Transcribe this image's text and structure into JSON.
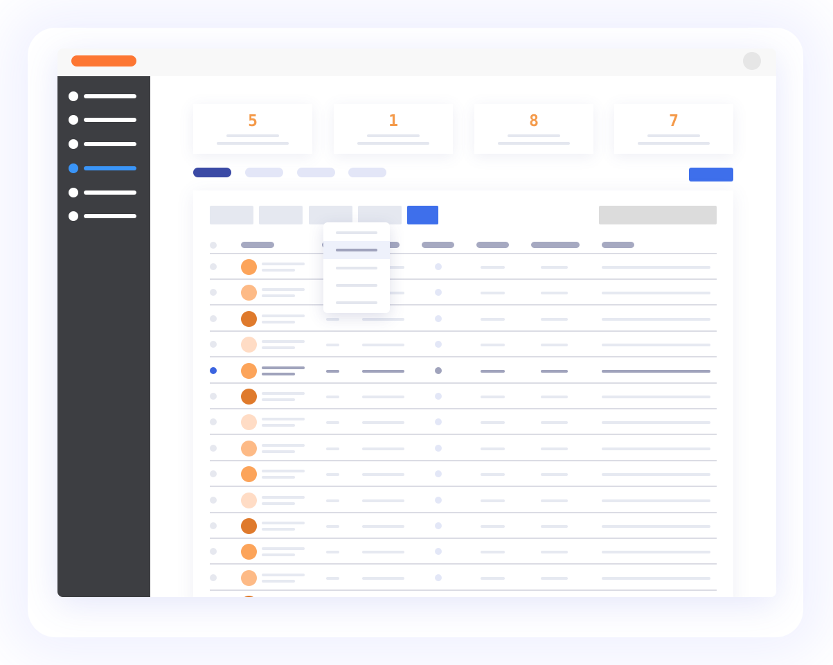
{
  "colors": {
    "accent_orange": "#fd7632",
    "sidebar_bg": "#3d3e42",
    "nav_active": "#3a95f8",
    "primary_blue": "#3e6feb",
    "tab_active": "#3b4aa5",
    "stat_number": "#f49a4a"
  },
  "sidebar": {
    "items": [
      {
        "icon": "dot-icon",
        "active": false
      },
      {
        "icon": "dot-icon",
        "active": false
      },
      {
        "icon": "dot-icon",
        "active": false
      },
      {
        "icon": "dot-icon",
        "active": true
      },
      {
        "icon": "dot-icon",
        "active": false
      },
      {
        "icon": "dot-icon",
        "active": false
      }
    ]
  },
  "stats": [
    {
      "value": "5"
    },
    {
      "value": "1"
    },
    {
      "value": "8"
    },
    {
      "value": "7"
    }
  ],
  "tabs": {
    "count": 4,
    "active_index": 0
  },
  "table": {
    "selected_row_index": 4,
    "avatar_colors": [
      "#fca45a",
      "#fdba86",
      "#df7a2c",
      "#ffdcc5",
      "#fca45a",
      "#df7a2c",
      "#ffdcc5",
      "#fdba86",
      "#fca45a",
      "#ffdcc5",
      "#df7a2c",
      "#fca45a",
      "#fdba86",
      "#df7a2c"
    ]
  },
  "dropdown": {
    "item_count": 5,
    "active_index": 1
  }
}
